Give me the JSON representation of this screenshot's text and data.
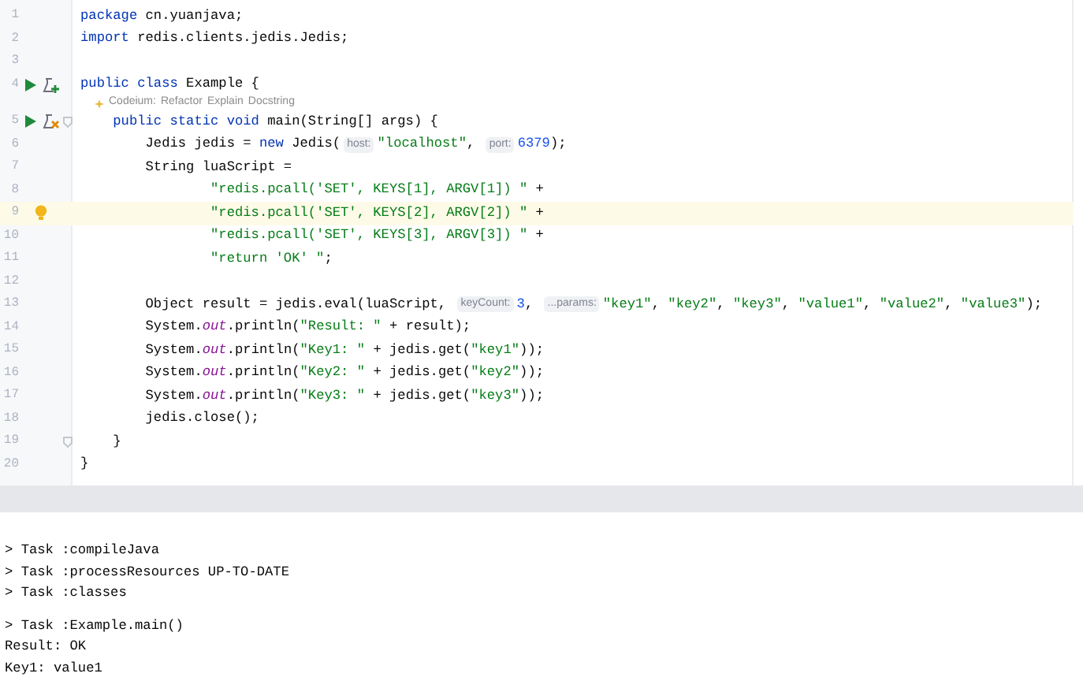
{
  "editor": {
    "lines": [
      {
        "number": "1",
        "tokens": [
          {
            "kind": "kw",
            "text": "package "
          },
          {
            "kind": "plain",
            "text": "cn.yuanjava;"
          }
        ]
      },
      {
        "number": "2",
        "tokens": [
          {
            "kind": "kw",
            "text": "import "
          },
          {
            "kind": "plain",
            "text": "redis.clients.jedis.Jedis;"
          }
        ]
      },
      {
        "number": "3"
      },
      {
        "number": "4",
        "gutter": {
          "kind": "run-class"
        },
        "tokens": [
          {
            "kind": "kw",
            "text": "public class "
          },
          {
            "kind": "plain",
            "text": "Example {"
          }
        ]
      },
      {
        "kind": "lens",
        "label": "Codeium:",
        "actions": [
          "Refactor",
          "Explain",
          "Docstring"
        ]
      },
      {
        "number": "5",
        "gutter": {
          "kind": "run-method"
        },
        "fold": true,
        "tokens": [
          {
            "kind": "kw",
            "text": "    public static void "
          },
          {
            "kind": "plain",
            "text": "main(String[] args) {"
          }
        ]
      },
      {
        "number": "6",
        "tokens": [
          {
            "kind": "plain",
            "text": "        Jedis jedis = "
          },
          {
            "kind": "kw",
            "text": "new "
          },
          {
            "kind": "plain",
            "text": "Jedis("
          },
          {
            "kind": "hint",
            "text": "host:"
          },
          {
            "kind": "str",
            "text": "\"localhost\""
          },
          {
            "kind": "plain",
            "text": ", "
          },
          {
            "kind": "hint",
            "text": "port:"
          },
          {
            "kind": "num",
            "text": "6379"
          },
          {
            "kind": "plain",
            "text": ");"
          }
        ]
      },
      {
        "number": "7",
        "tokens": [
          {
            "kind": "plain",
            "text": "        String luaScript ="
          }
        ]
      },
      {
        "number": "8",
        "tokens": [
          {
            "kind": "str",
            "text": "                \"redis.pcall('SET', KEYS[1], ARGV[1]) \""
          },
          {
            "kind": "plain",
            "text": " +"
          }
        ]
      },
      {
        "number": "9",
        "current": true,
        "gutter": {
          "kind": "intention"
        },
        "tokens": [
          {
            "kind": "str",
            "text": "                \"redis.pcall('SET', KEYS[2], ARGV[2]) \""
          },
          {
            "kind": "plain",
            "text": " +"
          }
        ]
      },
      {
        "number": "10",
        "tokens": [
          {
            "kind": "str",
            "text": "                \"redis.pcall('SET', KEYS[3], ARGV[3]) \""
          },
          {
            "kind": "plain",
            "text": " +"
          }
        ]
      },
      {
        "number": "11",
        "tokens": [
          {
            "kind": "str",
            "text": "                \"return 'OK' \""
          },
          {
            "kind": "plain",
            "text": ";"
          }
        ]
      },
      {
        "number": "12"
      },
      {
        "number": "13",
        "tokens": [
          {
            "kind": "plain",
            "text": "        Object result = jedis.eval(luaScript, "
          },
          {
            "kind": "hint",
            "text": "keyCount:"
          },
          {
            "kind": "num",
            "text": "3"
          },
          {
            "kind": "plain",
            "text": ", "
          },
          {
            "kind": "hint",
            "text": "...params:"
          },
          {
            "kind": "str",
            "text": "\"key1\""
          },
          {
            "kind": "plain",
            "text": ", "
          },
          {
            "kind": "str",
            "text": "\"key2\""
          },
          {
            "kind": "plain",
            "text": ", "
          },
          {
            "kind": "str",
            "text": "\"key3\""
          },
          {
            "kind": "plain",
            "text": ", "
          },
          {
            "kind": "str",
            "text": "\"value1\""
          },
          {
            "kind": "plain",
            "text": ", "
          },
          {
            "kind": "str",
            "text": "\"value2\""
          },
          {
            "kind": "plain",
            "text": ", "
          },
          {
            "kind": "str",
            "text": "\"value3\""
          },
          {
            "kind": "plain",
            "text": ");"
          }
        ]
      },
      {
        "number": "14",
        "tokens": [
          {
            "kind": "plain",
            "text": "        System."
          },
          {
            "kind": "field",
            "text": "out"
          },
          {
            "kind": "plain",
            "text": ".println("
          },
          {
            "kind": "str",
            "text": "\"Result: \""
          },
          {
            "kind": "plain",
            "text": " + result);"
          }
        ]
      },
      {
        "number": "15",
        "tokens": [
          {
            "kind": "plain",
            "text": "        System."
          },
          {
            "kind": "field",
            "text": "out"
          },
          {
            "kind": "plain",
            "text": ".println("
          },
          {
            "kind": "str",
            "text": "\"Key1: \""
          },
          {
            "kind": "plain",
            "text": " + jedis.get("
          },
          {
            "kind": "str",
            "text": "\"key1\""
          },
          {
            "kind": "plain",
            "text": "));"
          }
        ]
      },
      {
        "number": "16",
        "tokens": [
          {
            "kind": "plain",
            "text": "        System."
          },
          {
            "kind": "field",
            "text": "out"
          },
          {
            "kind": "plain",
            "text": ".println("
          },
          {
            "kind": "str",
            "text": "\"Key2: \""
          },
          {
            "kind": "plain",
            "text": " + jedis.get("
          },
          {
            "kind": "str",
            "text": "\"key2\""
          },
          {
            "kind": "plain",
            "text": "));"
          }
        ]
      },
      {
        "number": "17",
        "tokens": [
          {
            "kind": "plain",
            "text": "        System."
          },
          {
            "kind": "field",
            "text": "out"
          },
          {
            "kind": "plain",
            "text": ".println("
          },
          {
            "kind": "str",
            "text": "\"Key3: \""
          },
          {
            "kind": "plain",
            "text": " + jedis.get("
          },
          {
            "kind": "str",
            "text": "\"key3\""
          },
          {
            "kind": "plain",
            "text": "));"
          }
        ]
      },
      {
        "number": "18",
        "tokens": [
          {
            "kind": "plain",
            "text": "        jedis.close();"
          }
        ]
      },
      {
        "number": "19",
        "fold": true,
        "tokens": [
          {
            "kind": "plain",
            "text": "    }"
          }
        ]
      },
      {
        "number": "20",
        "tokens": [
          {
            "kind": "plain",
            "text": "}"
          }
        ]
      }
    ]
  },
  "console": {
    "blocks": [
      [
        "> Task :compileJava",
        "> Task :processResources UP-TO-DATE",
        "> Task :classes"
      ],
      [
        "> Task :Example.main()",
        "Result: OK",
        "Key1: value1"
      ]
    ]
  }
}
